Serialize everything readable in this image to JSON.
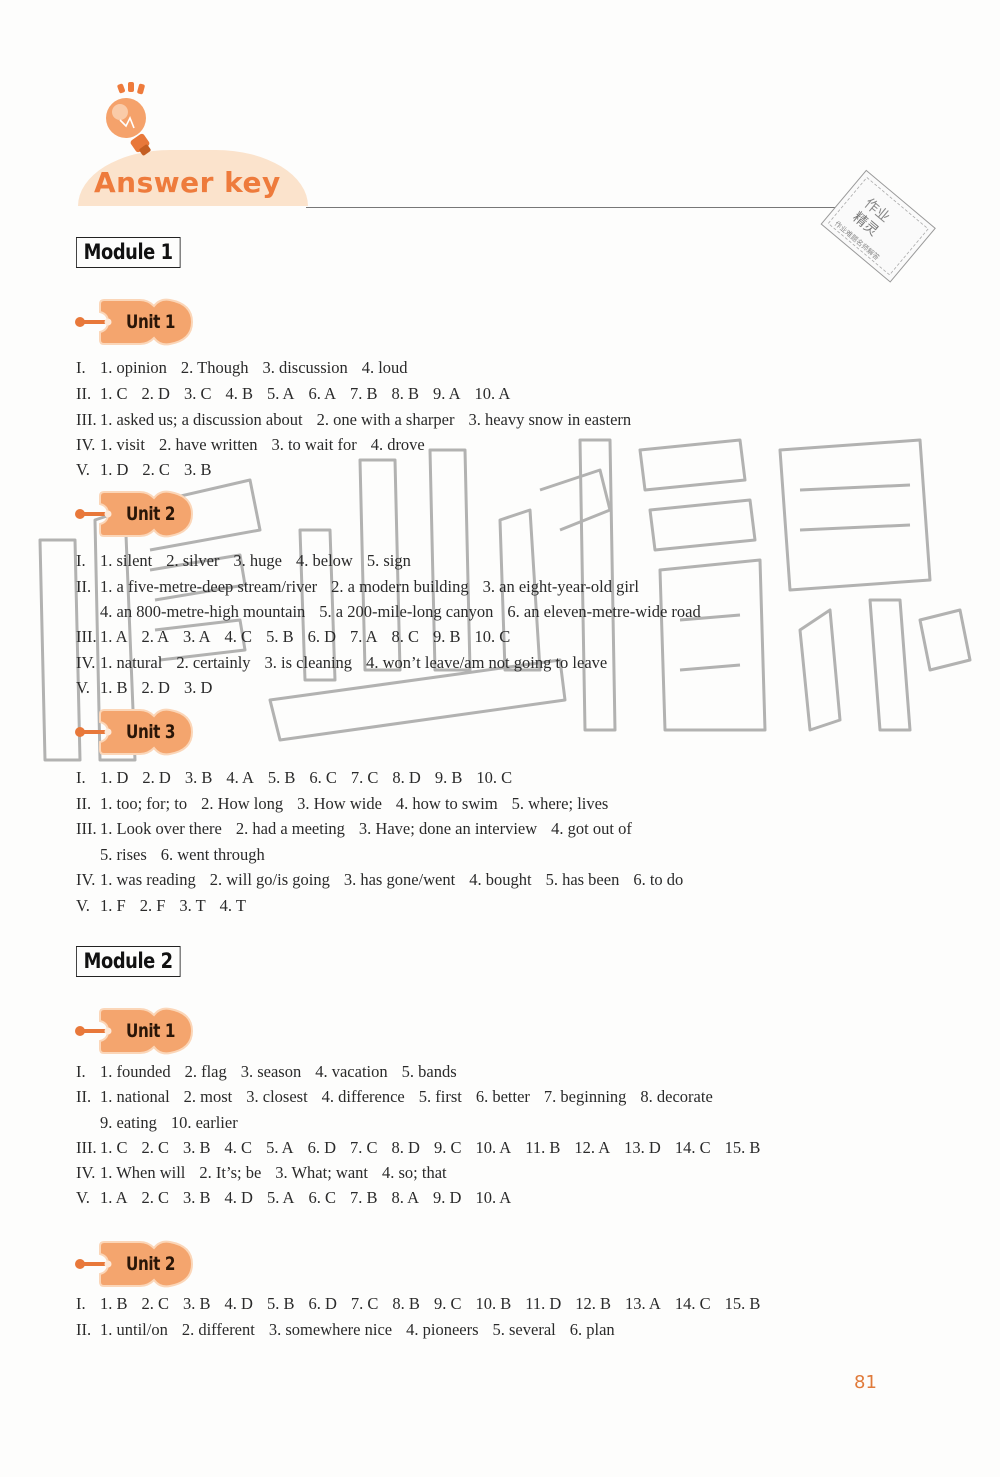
{
  "header": {
    "title": "Answer key",
    "icon": "lightbulb-icon"
  },
  "stamp": {
    "line1": "作业",
    "line2": "精灵",
    "line3": "作业难题名师解答"
  },
  "watermark": {
    "text": "作业精灵"
  },
  "page_number": "81",
  "colors": {
    "accent": "#ee7b3c",
    "dome": "#fbe3cc",
    "tag": "#f4a56e",
    "page_number": "#e07a3a"
  },
  "modules": [
    {
      "title": "Module 1",
      "units": [
        {
          "title": "Unit 1",
          "lines": [
            {
              "num": "I.",
              "items": [
                "1. opinion",
                "2. Though",
                "3. discussion",
                "4. loud"
              ]
            },
            {
              "num": "II.",
              "items": [
                "1. C",
                "2. D",
                "3. C",
                "4. B",
                "5. A",
                "6. A",
                "7. B",
                "8. B",
                "9. A",
                "10. A"
              ]
            },
            {
              "num": "III.",
              "items": [
                "1. asked us; a discussion about",
                "2. one with a sharper",
                "3. heavy snow in eastern"
              ]
            },
            {
              "num": "IV.",
              "items": [
                "1. visit",
                "2. have written",
                "3. to wait for",
                "4. drove"
              ]
            },
            {
              "num": "V.",
              "items": [
                "1. D",
                "2. C",
                "3. B"
              ]
            }
          ]
        },
        {
          "title": "Unit 2",
          "lines": [
            {
              "num": "I.",
              "items": [
                "1. silent",
                "2. silver",
                "3. huge",
                "4. below",
                "5. sign"
              ]
            },
            {
              "num": "II.",
              "items": [
                "1. a five-metre-deep stream/river",
                "2. a modern building",
                "3. an eight-year-old girl"
              ]
            },
            {
              "num": "",
              "items": [
                "4. an 800-metre-high mountain",
                "5. a 200-mile-long canyon",
                "6. an eleven-metre-wide road"
              ]
            },
            {
              "num": "III.",
              "items": [
                "1. A",
                "2. A",
                "3. A",
                "4. C",
                "5. B",
                "6. D",
                "7. A",
                "8. C",
                "9. B",
                "10. C"
              ]
            },
            {
              "num": "IV.",
              "items": [
                "1. natural",
                "2. certainly",
                "3. is cleaning",
                "4. won’t leave/am not going to leave"
              ]
            },
            {
              "num": "V.",
              "items": [
                "1. B",
                "2. D",
                "3. D"
              ]
            }
          ]
        },
        {
          "title": "Unit 3",
          "lines": [
            {
              "num": "I.",
              "items": [
                "1. D",
                "2. D",
                "3. B",
                "4. A",
                "5. B",
                "6. C",
                "7. C",
                "8. D",
                "9. B",
                "10. C"
              ]
            },
            {
              "num": "II.",
              "items": [
                "1. too; for; to",
                "2. How long",
                "3. How wide",
                "4. how to swim",
                "5. where; lives"
              ]
            },
            {
              "num": "III.",
              "items": [
                "1. Look over there",
                "2. had a meeting",
                "3. Have; done an interview",
                "4. got out of"
              ]
            },
            {
              "num": "",
              "items": [
                "5. rises",
                "6. went through"
              ]
            },
            {
              "num": "IV.",
              "items": [
                "1. was reading",
                "2. will go/is going",
                "3. has gone/went",
                "4. bought",
                "5. has been",
                "6. to do"
              ]
            },
            {
              "num": "V.",
              "items": [
                "1. F",
                "2. F",
                "3. T",
                "4. T"
              ]
            }
          ]
        }
      ]
    },
    {
      "title": "Module 2",
      "units": [
        {
          "title": "Unit 1",
          "lines": [
            {
              "num": "I.",
              "items": [
                "1. founded",
                "2. flag",
                "3. season",
                "4. vacation",
                "5. bands"
              ]
            },
            {
              "num": "II.",
              "items": [
                "1. national",
                "2. most",
                "3. closest",
                "4. difference",
                "5. first",
                "6. better",
                "7. beginning",
                "8. decorate"
              ]
            },
            {
              "num": "",
              "items": [
                "9. eating",
                "10. earlier"
              ]
            },
            {
              "num": "III.",
              "items": [
                "1. C",
                "2. C",
                "3. B",
                "4. C",
                "5. A",
                "6. D",
                "7. C",
                "8. D",
                "9. C",
                "10. A",
                "11. B",
                "12. A",
                "13. D",
                "14. C",
                "15. B"
              ]
            },
            {
              "num": "IV.",
              "items": [
                "1. When will",
                "2. It’s; be",
                "3. What; want",
                "4. so; that"
              ]
            },
            {
              "num": "V.",
              "items": [
                "1. A",
                "2. C",
                "3. B",
                "4. D",
                "5. A",
                "6. C",
                "7. B",
                "8. A",
                "9. D",
                "10. A"
              ]
            }
          ]
        },
        {
          "title": "Unit 2",
          "lines": [
            {
              "num": "I.",
              "items": [
                "1. B",
                "2. C",
                "3. B",
                "4. D",
                "5. B",
                "6. D",
                "7. C",
                "8. B",
                "9. C",
                "10. B",
                "11. D",
                "12. B",
                "13. A",
                "14. C",
                "15. B"
              ]
            },
            {
              "num": "II.",
              "items": [
                "1. until/on",
                "2. different",
                "3. somewhere nice",
                "4. pioneers",
                "5. several",
                "6. plan"
              ]
            }
          ]
        }
      ]
    }
  ]
}
